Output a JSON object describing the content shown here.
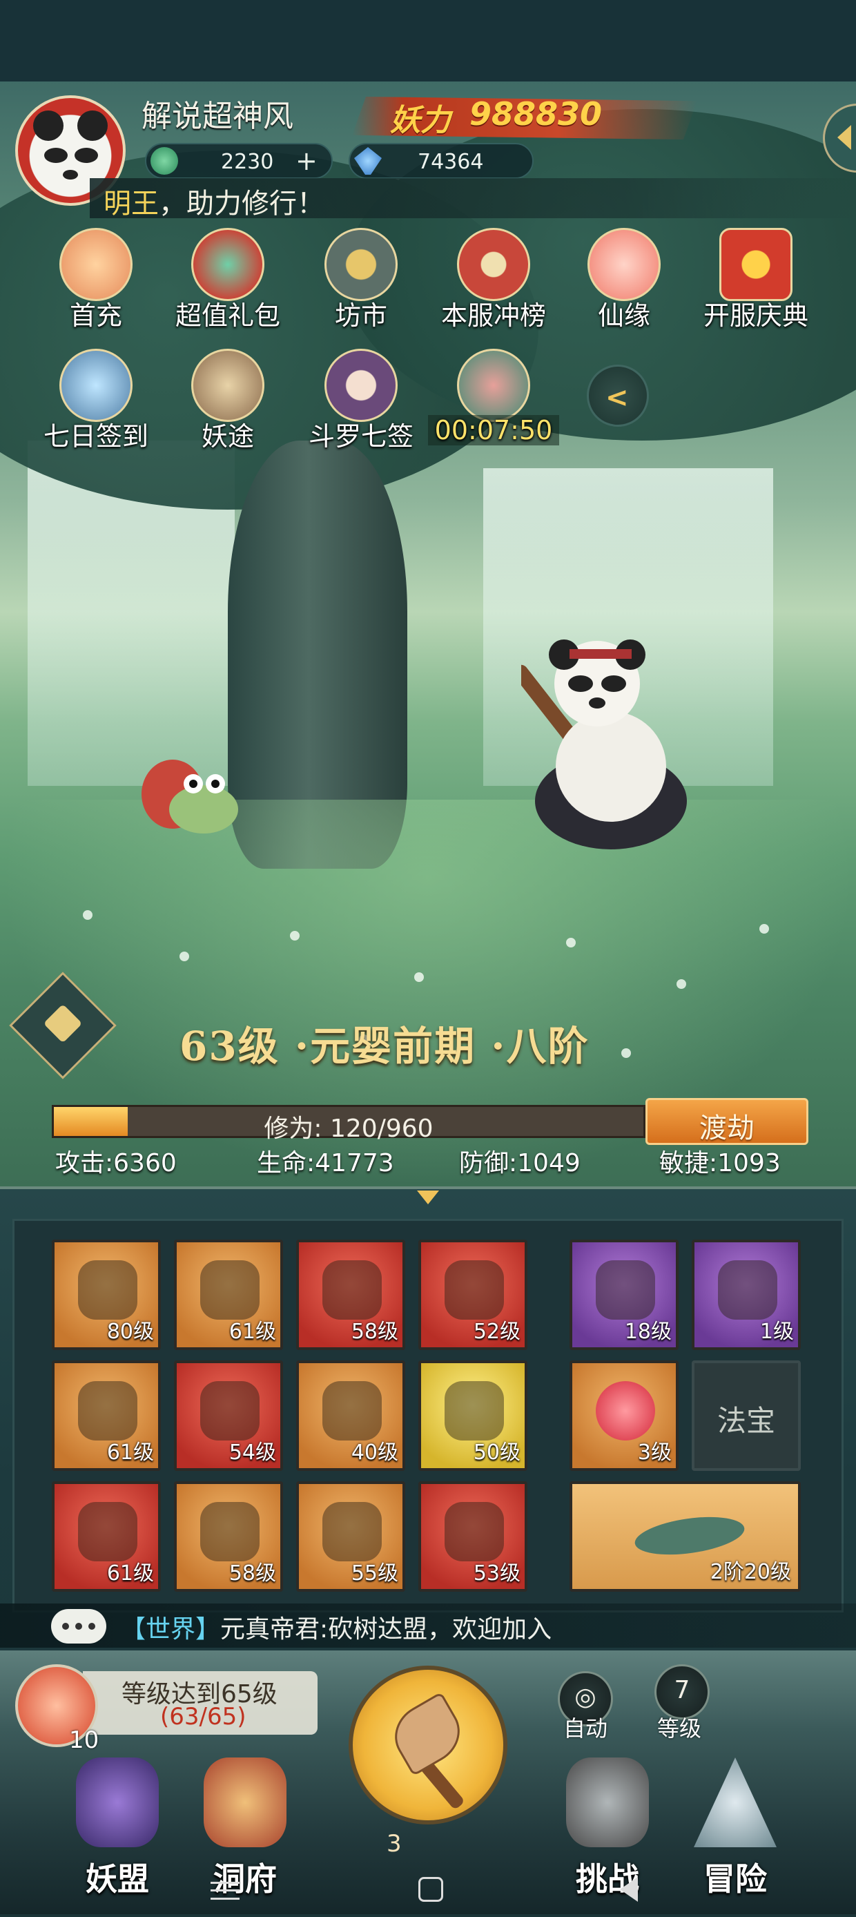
{
  "player": {
    "name": "解说超神风",
    "power_label": "妖力",
    "power_value": "988830",
    "jade": "2230",
    "jade_plus": "+",
    "crystal": "74364",
    "tagline_highlight": "明王",
    "tagline_rest": "，助力修行！"
  },
  "activities": [
    {
      "label": "首充",
      "icon": "flower-icon",
      "color": "#f2a26a"
    },
    {
      "label": "超值礼包",
      "icon": "gem-bag-icon",
      "color": "#d64d3c"
    },
    {
      "label": "坊市",
      "icon": "coin-icon",
      "color": "#5c6f68"
    },
    {
      "label": "本服冲榜",
      "icon": "shrine-icon",
      "color": "#c8473a"
    },
    {
      "label": "仙缘",
      "icon": "lotus-icon",
      "color": "#f49a8a"
    },
    {
      "label": "开服庆典",
      "icon": "gift-icon",
      "color": "#d23c2c"
    },
    {
      "label": "七日签到",
      "icon": "compass-icon",
      "color": "#4f7da4"
    },
    {
      "label": "妖途",
      "icon": "book-icon",
      "color": "#8a6a4c"
    },
    {
      "label": "斗罗七签",
      "icon": "character-icon",
      "color": "#6a4a7a"
    },
    {
      "label": "00:07:50",
      "icon": "lucky-bag-icon",
      "color": "#3f8a72"
    }
  ],
  "collapse_symbol": "<",
  "level": {
    "text": "63级 ·元婴前期 ·八阶",
    "xp_text": "修为: 120/960",
    "xp_current": 120,
    "xp_max": 960,
    "breakthrough_label": "渡劫"
  },
  "stats": {
    "attack": "攻击:6360",
    "hp": "生命:41773",
    "defense": "防御:1049",
    "agility": "敏捷:1093"
  },
  "equipment": [
    {
      "level": "80级",
      "color": "orange",
      "icon": "sword-icon"
    },
    {
      "level": "61级",
      "color": "orange",
      "icon": "headgear-icon"
    },
    {
      "level": "58级",
      "color": "red",
      "icon": "robe-icon"
    },
    {
      "level": "52级",
      "color": "red",
      "icon": "bracer-icon"
    },
    {
      "level": "61级",
      "color": "orange",
      "icon": "belt-icon"
    },
    {
      "level": "54级",
      "color": "red",
      "icon": "boots-icon"
    },
    {
      "level": "40级",
      "color": "orange",
      "icon": "orb-icon"
    },
    {
      "level": "50级",
      "color": "yellow",
      "icon": "ring-icon"
    },
    {
      "level": "61级",
      "color": "red",
      "icon": "mask-icon"
    },
    {
      "level": "58级",
      "color": "orange",
      "icon": "beast-icon"
    },
    {
      "level": "55级",
      "color": "orange",
      "icon": "gourd-icon"
    },
    {
      "level": "53级",
      "color": "red",
      "icon": "demon-mask-icon"
    }
  ],
  "companions": [
    {
      "level": "18级",
      "color": "purple",
      "icon": "deer-icon"
    },
    {
      "level": "1级",
      "color": "purple",
      "icon": "sage-icon"
    },
    {
      "level": "3级",
      "color": "orange",
      "icon": "red-pearl-icon"
    },
    {
      "label": "法宝",
      "color": "gray"
    }
  ],
  "mount": {
    "level": "2阶20级",
    "icon": "flying-sword-icon"
  },
  "chat": {
    "channel": "【世界】",
    "message": "元真帝君:砍树达盟，欢迎加入"
  },
  "quest": {
    "count": "10",
    "title": "等级达到65级",
    "progress": "(63/65)"
  },
  "main_action": {
    "count": "3"
  },
  "auto_label": "自动",
  "grade_value": "7",
  "grade_label": "等级",
  "nav": [
    {
      "label": "妖盟",
      "icon": "alliance-icon",
      "color": "#4a3a7a"
    },
    {
      "label": "洞府",
      "icon": "cave-house-icon",
      "color": "#a8442e"
    },
    {
      "label": "挑战",
      "icon": "gourd-challenge-icon",
      "color": "#5d5a5a"
    },
    {
      "label": "冒险",
      "icon": "mountain-icon",
      "color": "#6f8a92"
    }
  ]
}
